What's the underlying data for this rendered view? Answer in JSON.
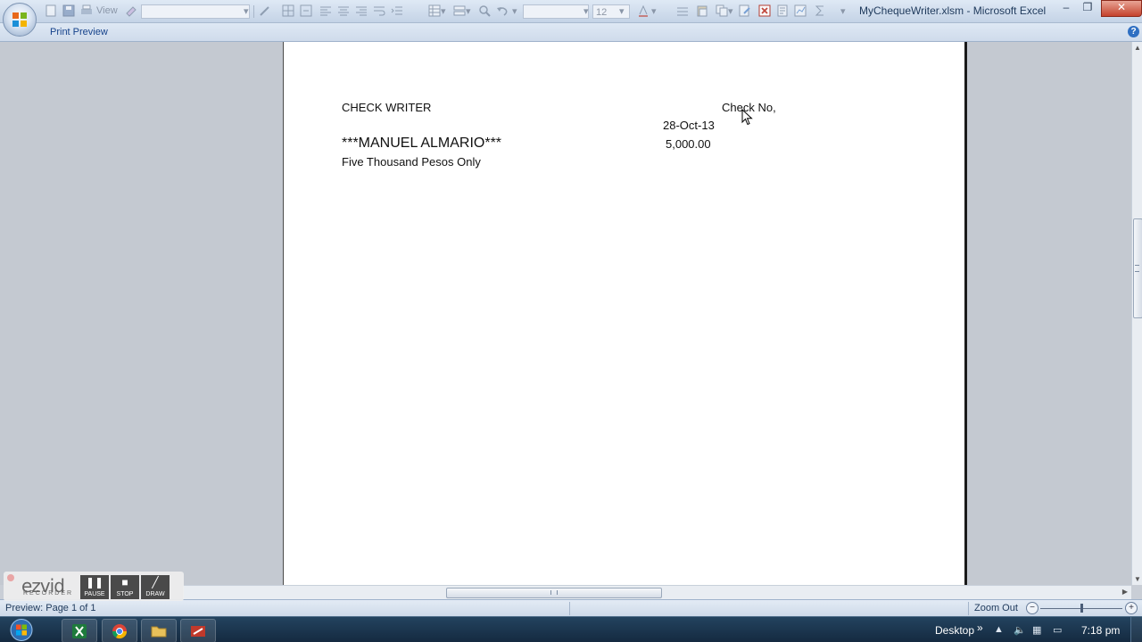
{
  "window": {
    "title": "MyChequeWriter.xlsm - Microsoft Excel",
    "minimize_glyph": "–",
    "restore_glyph": "❐",
    "close_glyph": "✕"
  },
  "toolbar": {
    "view_label": "View",
    "font_size": "12"
  },
  "ribbon": {
    "tab_label": "Print Preview",
    "help_glyph": "?"
  },
  "sheet": {
    "title": "CHECK WRITER",
    "check_no_label": "Check No,",
    "date": "28-Oct-13",
    "payee": "***MANUEL ALMARIO***",
    "amount": "5,000.00",
    "amount_in_words": "Five Thousand  Pesos Only"
  },
  "statusbar": {
    "preview_text": "Preview: Page 1 of 1",
    "zoom_label": "Zoom Out",
    "zoom_minus": "−",
    "zoom_plus": "+"
  },
  "recorder": {
    "logo": "ezvid",
    "sub": "RECORDER",
    "pause": "PAUSE",
    "stop": "STOP",
    "draw": "DRAW"
  },
  "taskbar": {
    "desktop_label": "Desktop",
    "chevron": "»",
    "time": "7:18 pm"
  },
  "colors": {
    "title_text": "#1e395b",
    "ribbon_tab": "#15428b",
    "taskbar": "#1b3550"
  }
}
